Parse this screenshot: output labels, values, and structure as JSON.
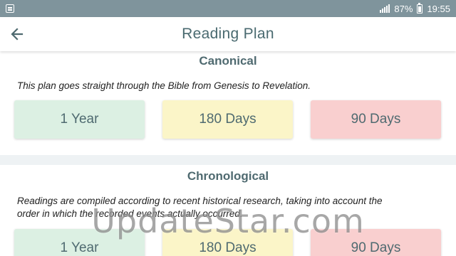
{
  "status_bar": {
    "battery": "87%",
    "time": "19:55",
    "icons": [
      "notification-icon",
      "signal-icon",
      "battery-icon"
    ]
  },
  "app_bar": {
    "title": "Reading Plan",
    "back_icon": "arrow-left-icon"
  },
  "plans": [
    {
      "title": "Canonical",
      "description": "This plan goes straight through the Bible from Genesis to Revelation.",
      "options": [
        "1 Year",
        "180 Days",
        "90 Days"
      ]
    },
    {
      "title": "Chronological",
      "description_line1": "Readings are compiled according to recent historical research, taking into account the",
      "description_line2": "order in which the recorded events actually occurred.",
      "options": [
        "1 Year",
        "180 Days",
        "90 Days"
      ]
    }
  ],
  "colors": {
    "status_bar": "#7f949c",
    "title_text": "#4f6a70",
    "option_1": "#dcf0e3",
    "option_2": "#fbf5c8",
    "option_3": "#f9cfcf"
  },
  "watermark": "UpdateStar.com"
}
